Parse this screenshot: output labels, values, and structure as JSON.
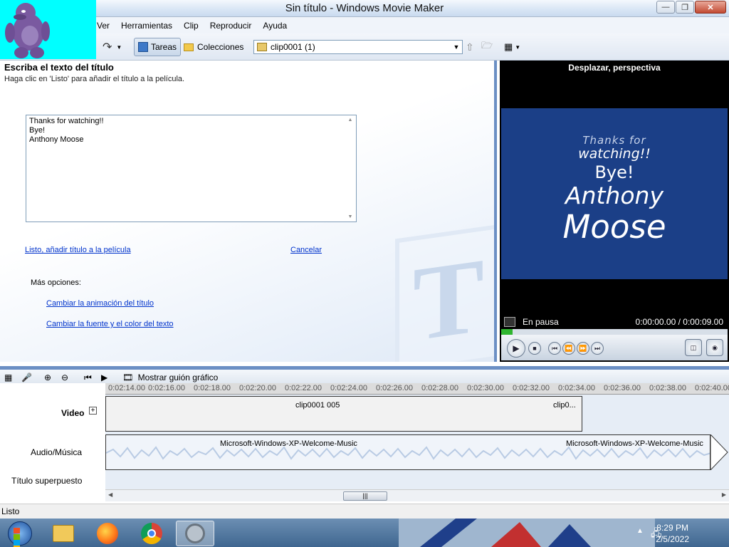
{
  "window": {
    "title": "Sin título - Windows Movie Maker"
  },
  "menu": [
    "Ver",
    "Herramientas",
    "Clip",
    "Reproducir",
    "Ayuda"
  ],
  "toolbar": {
    "tasks_label": "Tareas",
    "collections_label": "Colecciones",
    "collection_select": "clip0001 (1)"
  },
  "task": {
    "heading": "Escriba el texto del título",
    "subtitle": "Haga clic en 'Listo' para añadir el título a la película.",
    "text_value": "Thanks for watching!!\nBye!\nAnthony Moose",
    "done_link": "Listo, añadir título a la película",
    "cancel_link": "Cancelar",
    "more_options": "Más opciones:",
    "change_animation": "Cambiar la animación del título",
    "change_font": "Cambiar la fuente y el color del texto"
  },
  "preview": {
    "title": "Desplazar, perspectiva",
    "lines": [
      "Thanks for",
      "watching!!",
      "Bye!",
      "Anthony",
      "Moose"
    ],
    "status": "En pausa",
    "time": "0:00:00.00 / 0:00:09.00",
    "progress": 0
  },
  "timeline": {
    "storyboard_label": "Mostrar guión gráfico",
    "ticks": [
      "0:02:14.00",
      "0:02:16.00",
      "0:02:18.00",
      "0:02:20.00",
      "0:02:22.00",
      "0:02:24.00",
      "0:02:26.00",
      "0:02:28.00",
      "0:02:30.00",
      "0:02:32.00",
      "0:02:34.00",
      "0:02:36.00",
      "0:02:38.00",
      "0:02:40.00"
    ],
    "tracks": {
      "video": "Video",
      "audio": "Audio/Música",
      "overlay": "Título superpuesto"
    },
    "video_clips": [
      "clip0001 005",
      "clip0..."
    ],
    "audio_clips": [
      "Microsoft-Windows-XP-Welcome-Music",
      "Microsoft-Windows-XP-Welcome-Music"
    ]
  },
  "status": "Listo",
  "taskbar": {
    "time": "8:29 PM",
    "date": "2/5/2022"
  },
  "colors": {
    "accent": "#6b8fc4",
    "preview_bg": "#1b3f87",
    "link": "#0033cc"
  }
}
